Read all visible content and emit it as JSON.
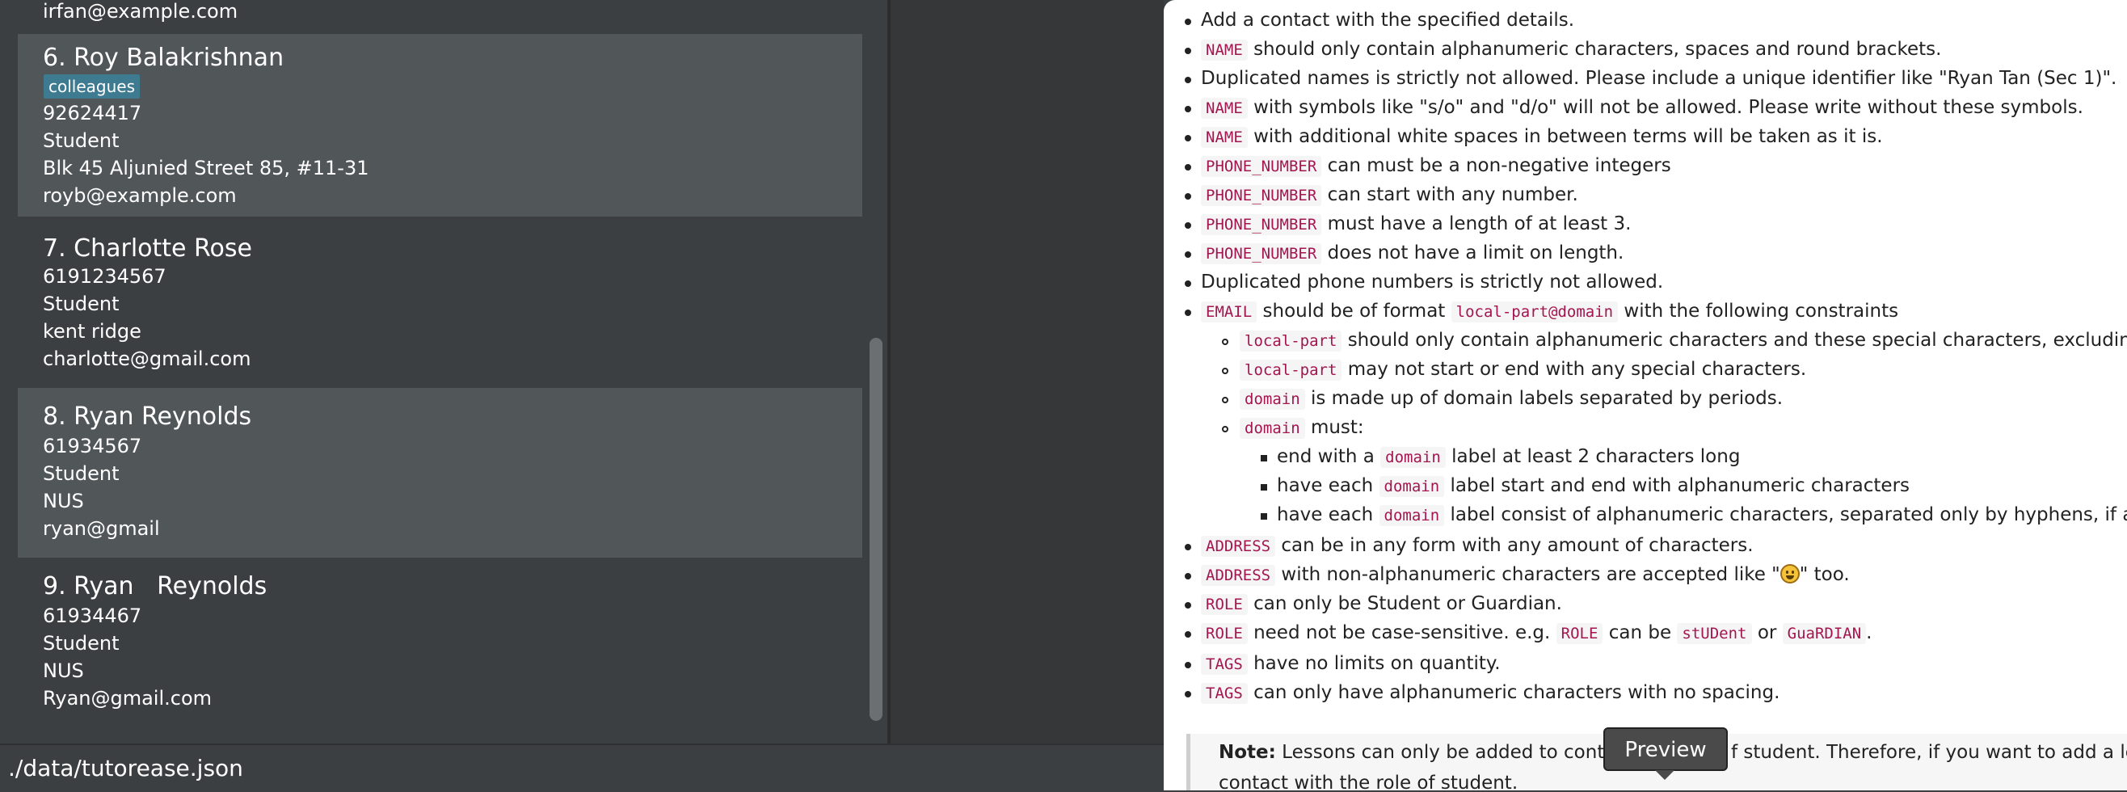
{
  "contacts": {
    "partial_email": "irfan@example.com",
    "items": [
      {
        "name": "6. Roy Balakrishnan",
        "tag": "colleagues",
        "phone": "92624417",
        "role": "Student",
        "address": "Blk 45 Aljunied Street 85, #11-31",
        "email": "royb@example.com"
      },
      {
        "name": "7. Charlotte Rose",
        "phone": "6191234567",
        "role": "Student",
        "address": "kent ridge",
        "email": "charlotte@gmail.com"
      },
      {
        "name": "8. Ryan Reynolds",
        "phone": "61934567",
        "role": "Student",
        "address": "NUS",
        "email": "ryan@gmail"
      },
      {
        "name": "9. Ryan   Reynolds",
        "phone": "61934467",
        "role": "Student",
        "address": "NUS",
        "email": "Ryan@gmail.com"
      }
    ]
  },
  "status_bar": {
    "path": "./data/tutorease.json"
  },
  "help": {
    "l1": "Add a contact with the specified details.",
    "name_code": "NAME",
    "phone_code": "PHONE_NUMBER",
    "email_code": "EMAIL",
    "address_code": "ADDRESS",
    "role_code": "ROLE",
    "tags_code": "TAGS",
    "local_code": "local-part",
    "domain_code": "domain",
    "email_format_code": "local-part@domain",
    "student_code": "stUDent",
    "guardian_code": "GuaRDIAN",
    "l2": "should only contain alphanumeric characters, spaces and round brackets.",
    "l3": "Duplicated names is strictly not allowed. Please include a unique identifier like \"Ryan Tan (Sec 1)\".",
    "l4": "with symbols like \"s/o\" and \"d/o\" will not be allowed. Please write without these symbols.",
    "l5": "with additional white spaces in between terms will be taken as it is.",
    "l6": "can must be a non-negative integers",
    "l7": "can start with any number.",
    "l8": "must have a length of at least 3.",
    "l9": "does not have a limit on length.",
    "l10": "Duplicated phone numbers is strictly not allowed.",
    "l11a": "should be of format",
    "l11b": "with the following constraints",
    "l12": "should only contain alphanumeric characters and these special characters, excluding th",
    "l13": "may not start or end with any special characters.",
    "l14": "is made up of domain labels separated by periods.",
    "l15": "must:",
    "l16a": "end with a",
    "l16b": "label at least 2 characters long",
    "l17a": "have each",
    "l17b": "label start and end with alphanumeric characters",
    "l18a": "have each",
    "l18b": "label consist of alphanumeric characters, separated only by hyphens, if any",
    "l19": "can be in any form with any amount of characters.",
    "l20a": "with non-alphanumeric characters are accepted like \"",
    "l20b": "\" too.",
    "l21": "can only be Student or Guardian.",
    "l22a": "need not be case-sensitive. e.g.",
    "l22b": "can be",
    "l22c": "or",
    "l22d": ".",
    "l23": "have no limits on quantity.",
    "l24": "can only have alphanumeric characters with no spacing.",
    "note_label": "Note:",
    "note_text_1": "Lessons can only be added to contacts",
    "note_text_1b": "f student. Therefore, if you want to add a lesso",
    "note_text_2": "contact with the role of student."
  },
  "tooltip": {
    "label": "Preview"
  }
}
